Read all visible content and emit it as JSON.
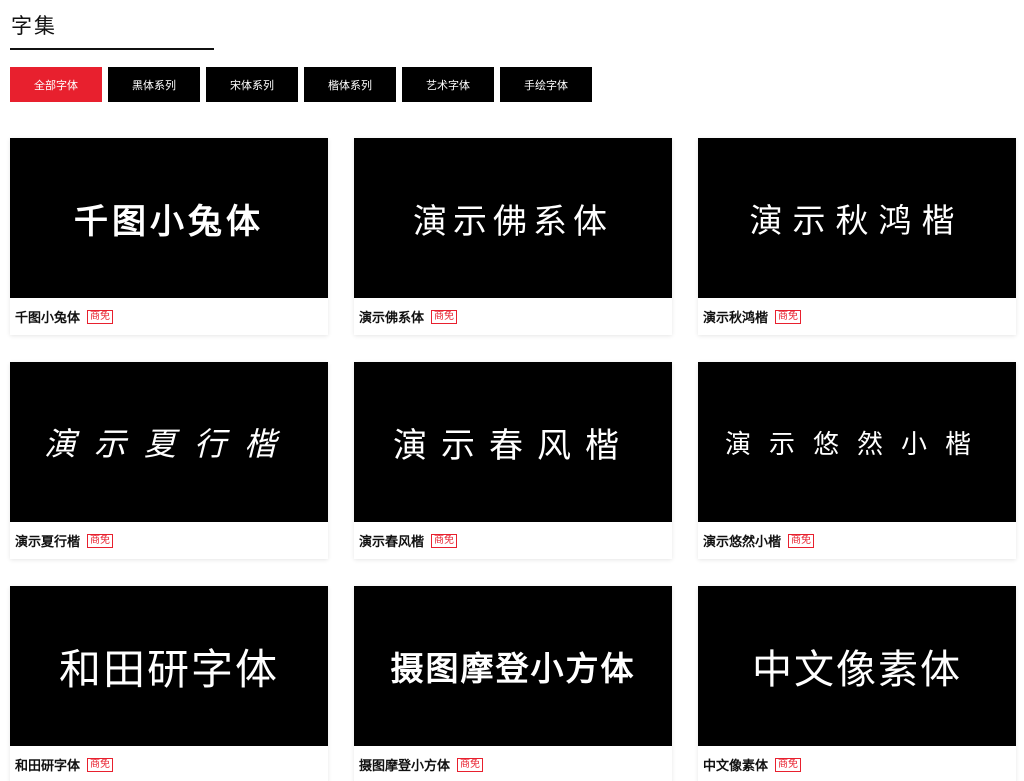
{
  "header": {
    "title": "字集"
  },
  "tabs": [
    {
      "label": "全部字体",
      "active": true
    },
    {
      "label": "黑体系列",
      "active": false
    },
    {
      "label": "宋体系列",
      "active": false
    },
    {
      "label": "楷体系列",
      "active": false
    },
    {
      "label": "艺术字体",
      "active": false
    },
    {
      "label": "手绘字体",
      "active": false
    }
  ],
  "cards": [
    {
      "preview": "千图小兔体",
      "name": "千图小兔体",
      "badge": "商免"
    },
    {
      "preview": "演示佛系体",
      "name": "演示佛系体",
      "badge": "商免"
    },
    {
      "preview": "演示秋鸿楷",
      "name": "演示秋鸿楷",
      "badge": "商免"
    },
    {
      "preview": "演示夏行楷",
      "name": "演示夏行楷",
      "badge": "商免"
    },
    {
      "preview": "演示春风楷",
      "name": "演示春风楷",
      "badge": "商免"
    },
    {
      "preview": "演示悠然小楷",
      "name": "演示悠然小楷",
      "badge": "商免"
    },
    {
      "preview": "和田研字体",
      "name": "和田研字体",
      "badge": "商免"
    },
    {
      "preview": "摄图摩登小方体",
      "name": "摄图摩登小方体",
      "badge": "商免"
    },
    {
      "preview": "中文像素体",
      "name": "中文像素体",
      "badge": "商免"
    }
  ],
  "colors": {
    "accent": "#e8202e",
    "tab_bg": "#000000",
    "preview_bg": "#000000"
  }
}
